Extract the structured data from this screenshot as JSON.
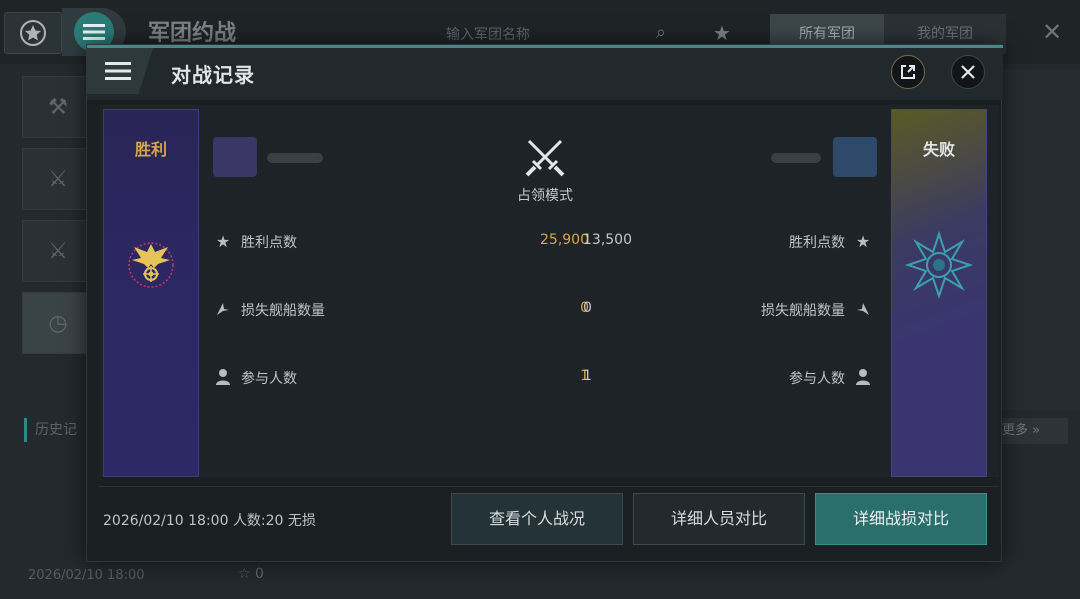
{
  "background": {
    "title": "军团约战",
    "search_placeholder": "输入军团名称",
    "tabs": [
      "所有军团",
      "我的军团"
    ],
    "history_label": "历史记",
    "more_label": "更多",
    "record_date": "2026/02/10 18:00",
    "record_count": "0"
  },
  "modal": {
    "title": "对战记录",
    "left_team": {
      "result": "胜利"
    },
    "right_team": {
      "result": "失败"
    },
    "mode": "占领模式",
    "stats": [
      {
        "label": "胜利点数",
        "icon": "star-icon",
        "left": "25,900",
        "right": "13,500"
      },
      {
        "label": "损失舰船数量",
        "icon": "ship-icon",
        "left": "0",
        "right": "0"
      },
      {
        "label": "参与人数",
        "icon": "person-icon",
        "left": "1",
        "right": "1"
      }
    ],
    "footer_info": "2026/02/10 18:00 人数:20 无损",
    "buttons": {
      "personal": "查看个人战况",
      "members": "详细人员对比",
      "losses": "详细战损对比"
    }
  },
  "colors": {
    "accent": "#2a6f6b",
    "victory_gold": "#d9a54a",
    "banner_purple": "#2c2762"
  }
}
